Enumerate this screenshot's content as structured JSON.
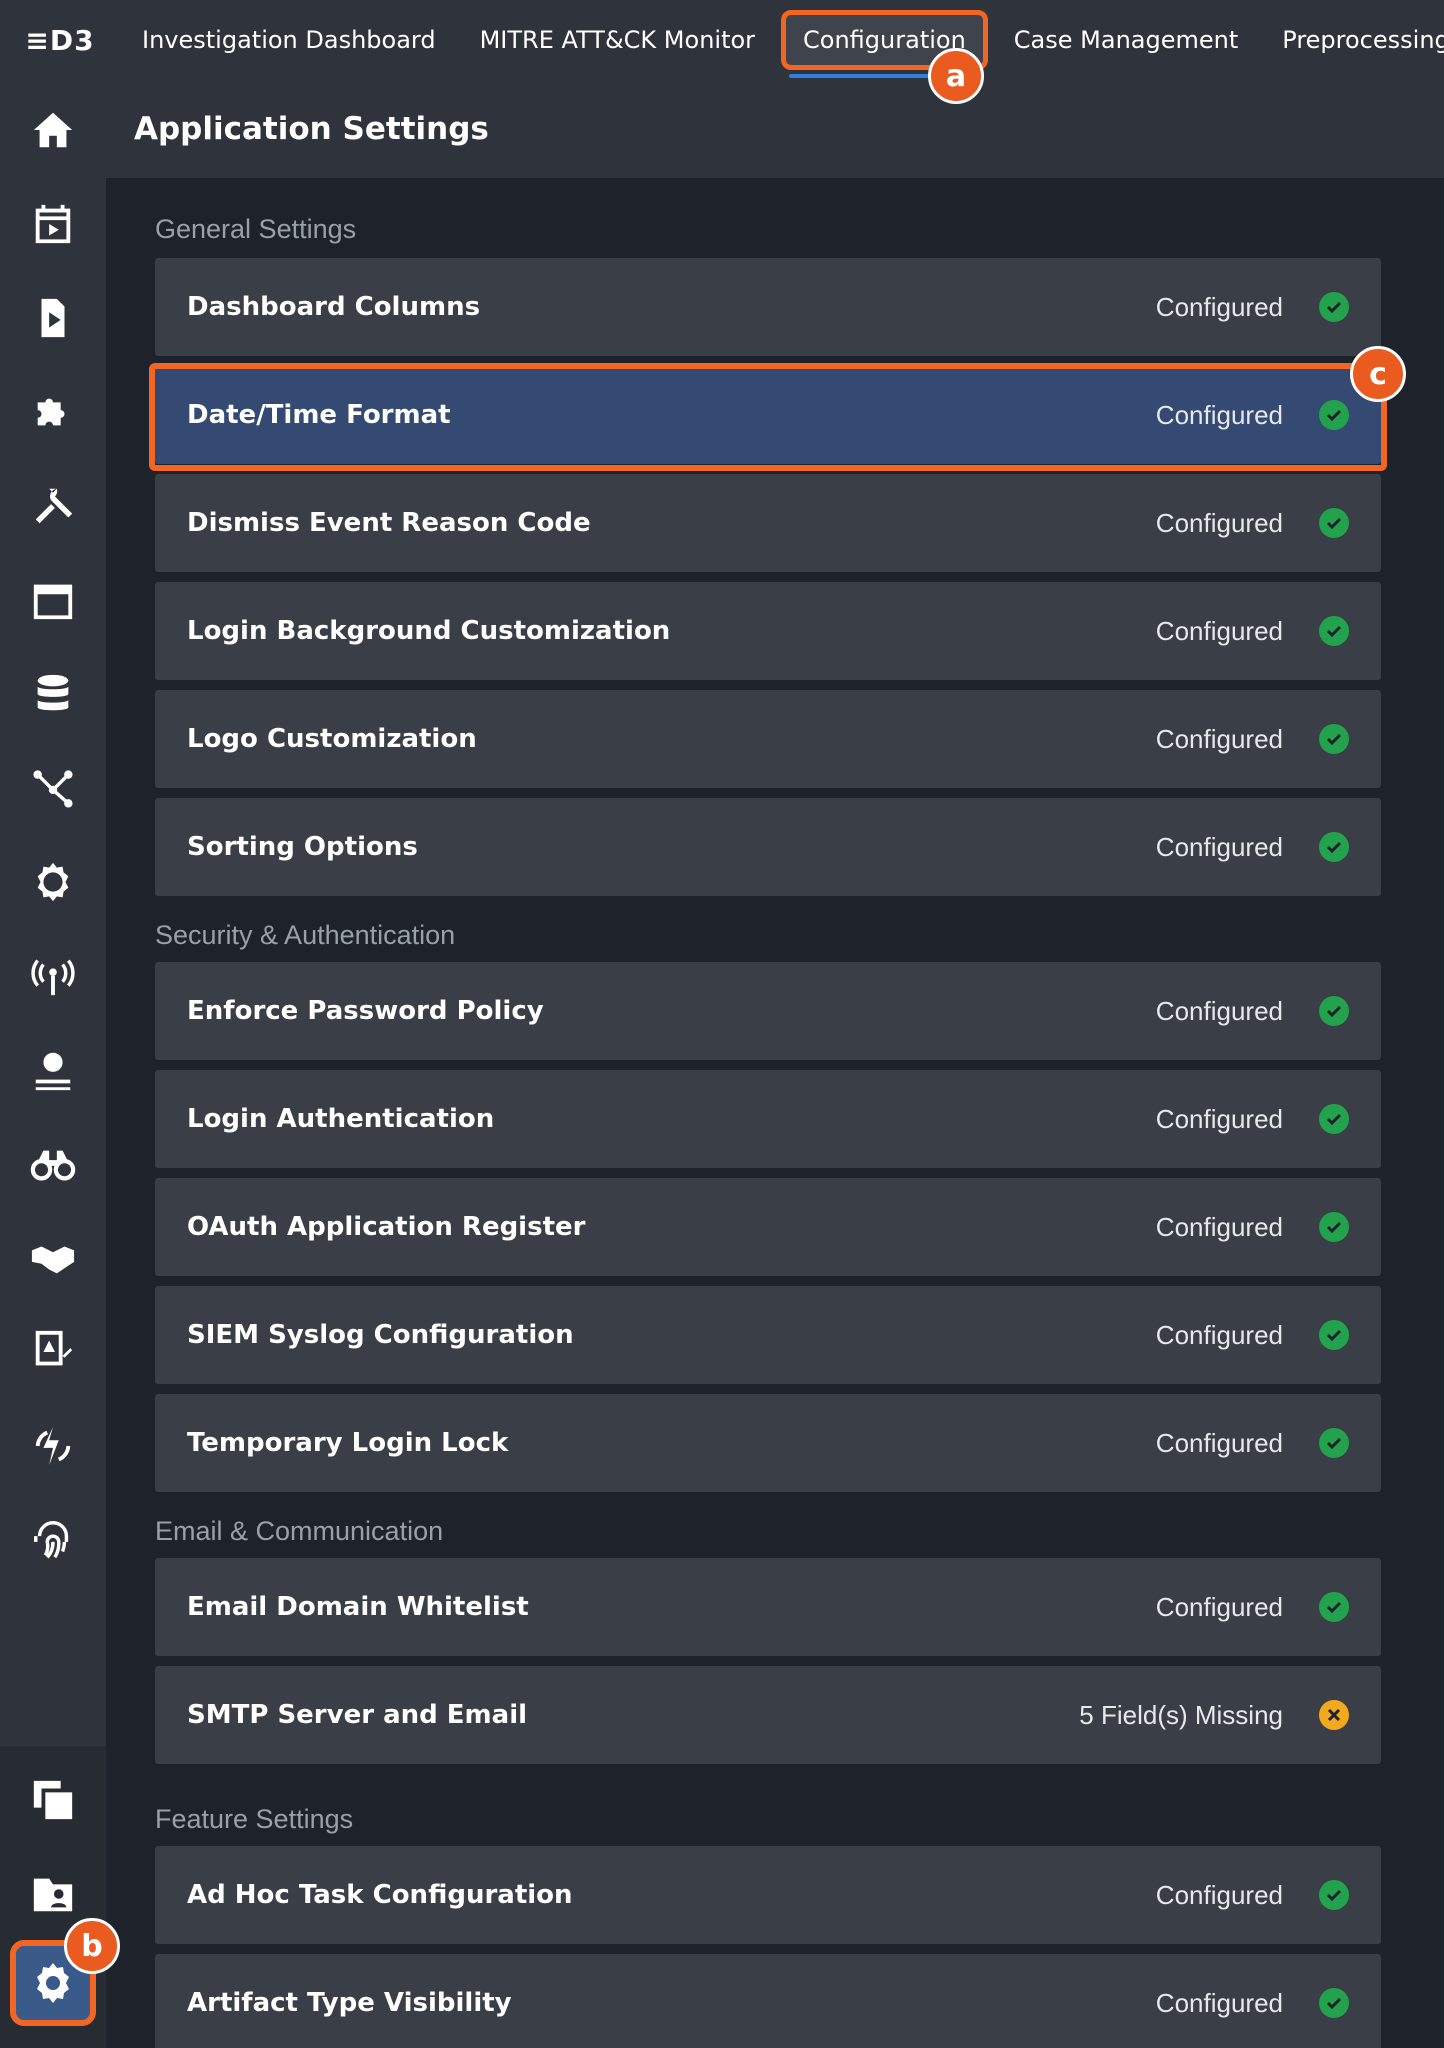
{
  "app": {
    "logo_text": "≡D3"
  },
  "nav": {
    "tabs": [
      {
        "label": "Investigation Dashboard"
      },
      {
        "label": "MITRE ATT&CK Monitor"
      },
      {
        "label": "Configuration",
        "active": true
      },
      {
        "label": "Case Management"
      },
      {
        "label": "Preprocessing Play"
      }
    ]
  },
  "markers": {
    "a": "a",
    "b": "b",
    "c": "c"
  },
  "header": {
    "title": "Application Settings"
  },
  "sidebar": {
    "icons": [
      "home-icon",
      "event-playbook-icon",
      "play-icon",
      "puzzle-icon",
      "tools-icon",
      "calendar-icon",
      "database-icon",
      "graph-icon",
      "api-gear-icon",
      "antenna-icon",
      "globe-network-icon",
      "binoculars-icon",
      "handshake-icon",
      "document-warning-icon",
      "sync-icon",
      "fingerprint-icon",
      "copy-icon",
      "folder-user-icon",
      "settings-gear-icon"
    ]
  },
  "sections": [
    {
      "title": "General Settings",
      "items": [
        {
          "name": "Dashboard Columns",
          "status": "Configured",
          "state": "ok"
        },
        {
          "name": "Date/Time Format",
          "status": "Configured",
          "state": "ok",
          "selected": true
        },
        {
          "name": "Dismiss Event Reason Code",
          "status": "Configured",
          "state": "ok"
        },
        {
          "name": "Login Background Customization",
          "status": "Configured",
          "state": "ok"
        },
        {
          "name": "Logo Customization",
          "status": "Configured",
          "state": "ok"
        },
        {
          "name": "Sorting Options",
          "status": "Configured",
          "state": "ok"
        }
      ]
    },
    {
      "title": "Security & Authentication",
      "items": [
        {
          "name": "Enforce Password Policy",
          "status": "Configured",
          "state": "ok"
        },
        {
          "name": "Login Authentication",
          "status": "Configured",
          "state": "ok"
        },
        {
          "name": "OAuth Application Register",
          "status": "Configured",
          "state": "ok"
        },
        {
          "name": "SIEM Syslog Configuration",
          "status": "Configured",
          "state": "ok"
        },
        {
          "name": "Temporary Login Lock",
          "status": "Configured",
          "state": "ok"
        }
      ]
    },
    {
      "title": "Email & Communication",
      "items": [
        {
          "name": "Email Domain Whitelist",
          "status": "Configured",
          "state": "ok"
        },
        {
          "name": "SMTP Server and Email",
          "status": "5 Field(s) Missing",
          "state": "warn"
        }
      ]
    },
    {
      "title": "Feature Settings",
      "items": [
        {
          "name": "Ad Hoc Task Configuration",
          "status": "Configured",
          "state": "ok"
        },
        {
          "name": "Artifact Type Visibility",
          "status": "Configured",
          "state": "ok"
        }
      ]
    }
  ],
  "colors": {
    "accent_highlight": "#f26522",
    "active_underline": "#2f7de1",
    "status_ok": "#23a24d",
    "status_warn": "#f2a91e",
    "selected_row": "#344a72"
  }
}
